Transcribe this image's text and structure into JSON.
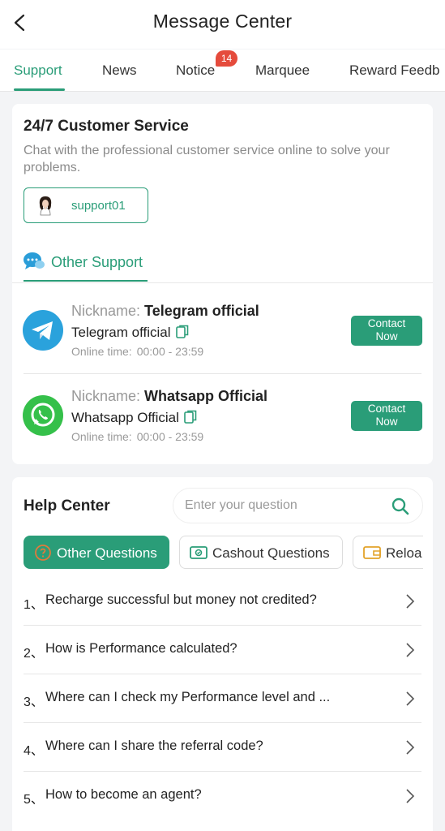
{
  "header": {
    "title": "Message Center"
  },
  "tabs": [
    {
      "label": "Support"
    },
    {
      "label": "News"
    },
    {
      "label": "Notice",
      "badge": "14"
    },
    {
      "label": "Marquee"
    },
    {
      "label": "Reward Feedb"
    }
  ],
  "customer_service": {
    "title": "24/7 Customer Service",
    "description": "Chat with the professional customer service online to solve your problems.",
    "agent": "support01"
  },
  "other_support": {
    "label": "Other Support",
    "contacts": [
      {
        "nickname_label": "Nickname:",
        "nickname": "Telegram official",
        "account": "Telegram official",
        "time_label": "Online time:",
        "time": "00:00 - 23:59",
        "button": "Contact Now",
        "icon": "telegram-icon"
      },
      {
        "nickname_label": "Nickname:",
        "nickname": "Whatsapp Official",
        "account": "Whatsapp Official",
        "time_label": "Online time:",
        "time": "00:00 - 23:59",
        "button": "Contact Now",
        "icon": "whatsapp-icon"
      }
    ]
  },
  "help_center": {
    "title": "Help Center",
    "search_placeholder": "Enter your question",
    "categories": [
      {
        "label": "Other Questions",
        "icon": "question-icon"
      },
      {
        "label": "Cashout Questions",
        "icon": "cash-icon"
      },
      {
        "label": "Reloa",
        "icon": "wallet-icon"
      }
    ],
    "questions": [
      {
        "num": "1、",
        "text": "Recharge successful but money not credited?"
      },
      {
        "num": "2、",
        "text": "How is Performance calculated?"
      },
      {
        "num": "3、",
        "text": "Where can I check my Performance level and ..."
      },
      {
        "num": "4、",
        "text": "Where can I share the referral code?"
      },
      {
        "num": "5、",
        "text": "How to become an agent?"
      }
    ]
  },
  "colors": {
    "accent": "#2a9d78",
    "badge": "#e54b3c",
    "telegram": "#2aa2dc",
    "whatsapp": "#35c04a"
  }
}
